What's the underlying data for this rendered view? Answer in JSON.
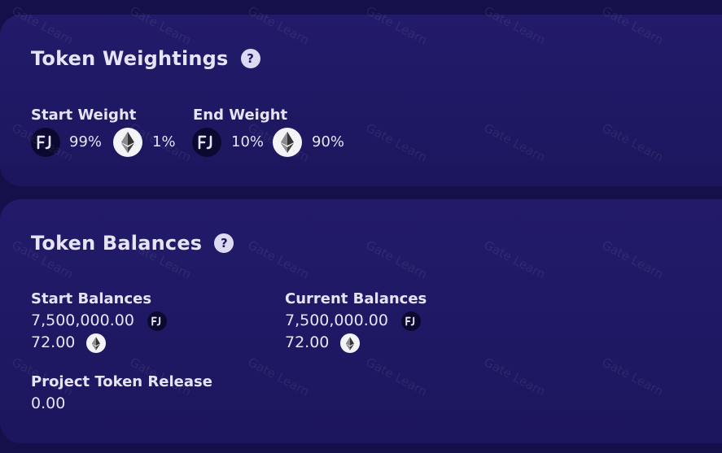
{
  "weightings": {
    "title": "Token Weightings",
    "help_icon": "question-icon",
    "start": {
      "label": "Start Weight",
      "project_pct": "99%",
      "eth_pct": "1%"
    },
    "end": {
      "label": "End Weight",
      "project_pct": "10%",
      "eth_pct": "90%"
    }
  },
  "balances": {
    "title": "Token Balances",
    "help_icon": "question-icon",
    "start": {
      "label": "Start Balances",
      "project_amount": "7,500,000.00",
      "eth_amount": "72.00"
    },
    "current": {
      "label": "Current Balances",
      "project_amount": "7,500,000.00",
      "eth_amount": "72.00"
    },
    "release": {
      "label": "Project Token Release",
      "value": "0.00"
    }
  },
  "tokens": {
    "project": {
      "icon": "fj-token-icon",
      "text": "FJ"
    },
    "eth": {
      "icon": "ethereum-icon"
    }
  },
  "watermark": "Gate Learn",
  "colors": {
    "background": "#151049",
    "card": "#1f1964",
    "text": "#e6e4f4",
    "fj_token_bg": "#0b0930",
    "eth_token_bg": "#f4f4f8"
  }
}
